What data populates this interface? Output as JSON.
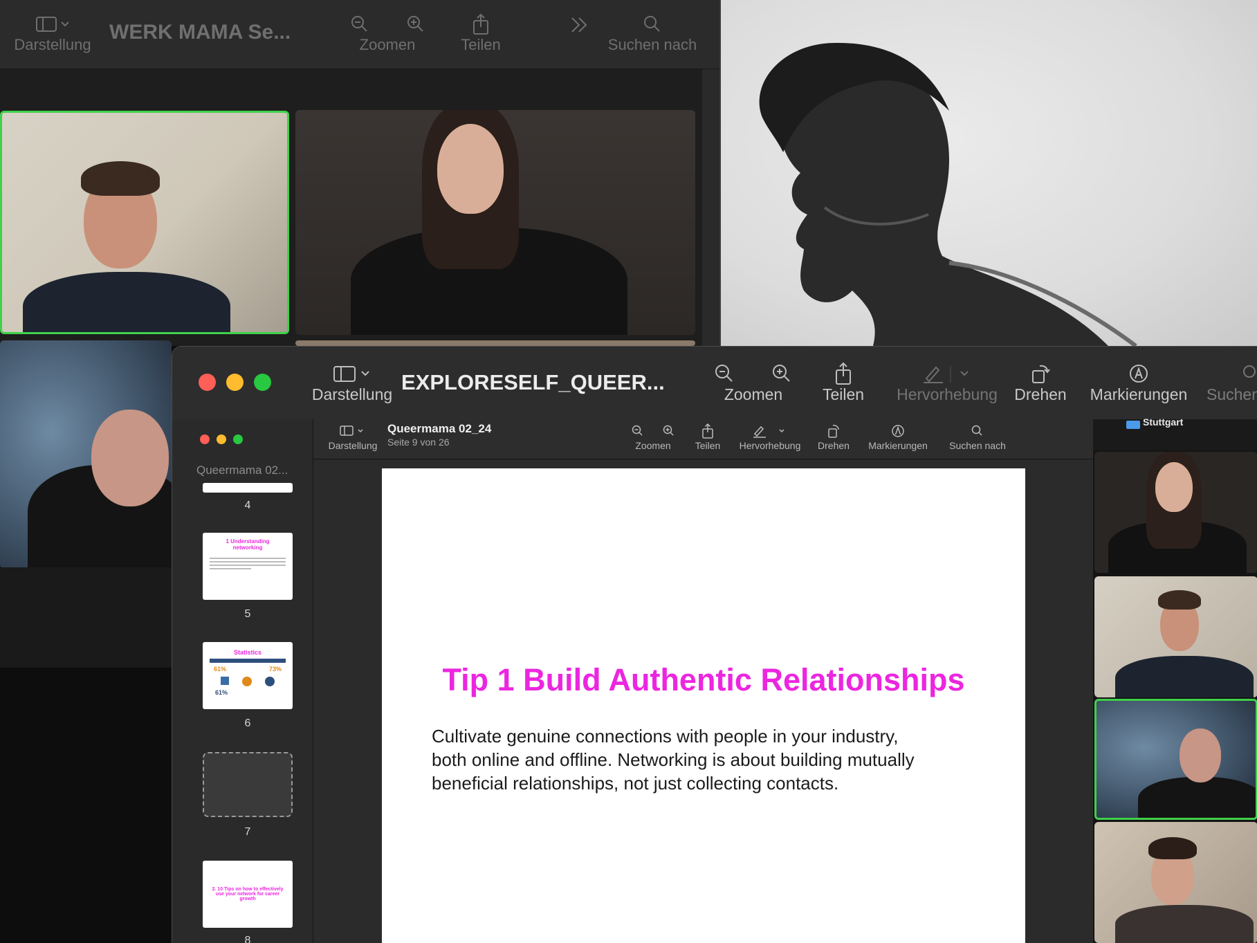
{
  "back_window": {
    "title": "WERK MAMA Se...",
    "toolbar": {
      "view_label": "Darstellung",
      "zoom_label": "Zoomen",
      "share_label": "Teilen",
      "search_label": "Suchen nach"
    }
  },
  "front_window": {
    "title": "EXPLORESELF_QUEER...",
    "toolbar": {
      "view_label": "Darstellung",
      "zoom_label": "Zoomen",
      "share_label": "Teilen",
      "highlight_label": "Hervorhebung",
      "rotate_label": "Drehen",
      "markup_label": "Markierungen",
      "search_label": "Suchen"
    }
  },
  "inner_window": {
    "sidebar_title": "Queermama 02...",
    "doc_title": "Queermama 02_24",
    "page_info": "Seite 9 von 26",
    "toolbar": {
      "view_label": "Darstellung",
      "zoom_label": "Zoomen",
      "share_label": "Teilen",
      "highlight_label": "Hervorhebung",
      "rotate_label": "Drehen",
      "markup_label": "Markierungen",
      "search_label": "Suchen nach"
    },
    "thumbnails": [
      {
        "page": "4"
      },
      {
        "page": "5",
        "title": "1 Understanding networking"
      },
      {
        "page": "6",
        "title": "Statistics",
        "stats": [
          "61%",
          "73%",
          "61%"
        ]
      },
      {
        "page": "7"
      },
      {
        "page": "8",
        "title": "2. 10 Tips on how to effectively use your network for career growth"
      }
    ]
  },
  "slide": {
    "heading": "Tip 1 Build Authentic Relationships",
    "body": "Cultivate genuine connections with people in your industry,\nboth online and offline. Networking is about building mutually\nbeneficial relationships, not just collecting contacts."
  },
  "video_strip": {
    "top_label": "Stuttgart"
  },
  "colors": {
    "slide_heading": "#ec26e0",
    "active_speaker": "#3fd14a",
    "close": "#fe5f57",
    "minimize": "#febc2e",
    "maximize": "#28c840"
  }
}
